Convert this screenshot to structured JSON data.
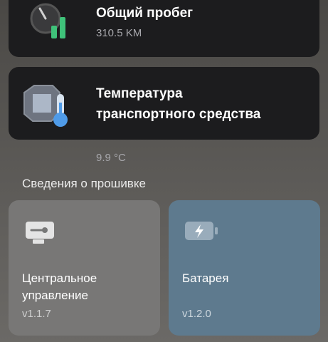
{
  "cards": {
    "mileage": {
      "title": "Общий пробег",
      "value": "310.5 KM",
      "icon": "odometer-icon"
    },
    "temperature": {
      "title": "Температура транспортного средства",
      "value": "9.9 °C",
      "icon": "vehicle-thermometer-icon"
    }
  },
  "firmware": {
    "section_title": "Сведения о прошивке",
    "items": [
      {
        "label": "Центральное управление",
        "version": "v1.1.7",
        "icon": "control-unit-icon",
        "color": "#787776"
      },
      {
        "label": "Батарея",
        "version": "v1.2.0",
        "icon": "battery-icon",
        "color": "#5e7a8e"
      }
    ]
  },
  "colors": {
    "card_bg": "#1c1c1e",
    "accent_green": "#3fc27a",
    "accent_blue": "#4f9be8"
  }
}
